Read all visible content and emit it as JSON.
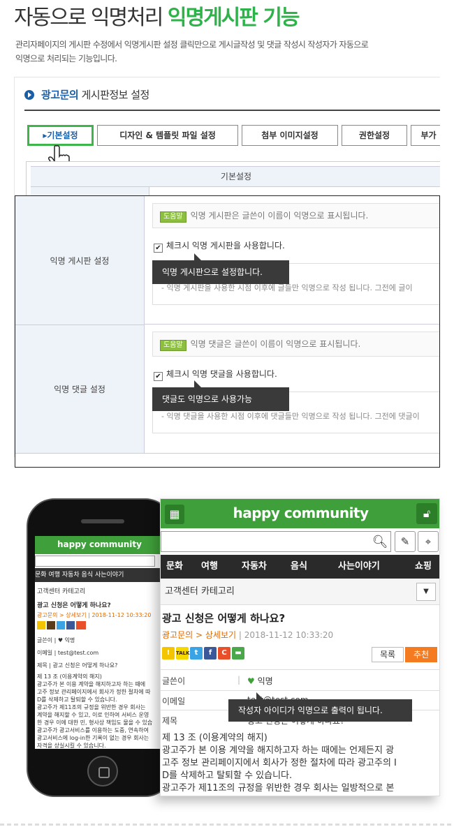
{
  "header": {
    "title_plain": "자동으로 익명처리 ",
    "title_highlight": "익명게시판 기능",
    "description_line1": "관리자페이지의 게시판 수정에서 익명게시판 설정 클릭만으로 게시글작성 및 댓글 작성시 작성자가 자동으로",
    "description_line2": "익명으로 처리되는 기능입니다."
  },
  "panel": {
    "heading_blue": "광고문의",
    "heading_rest": " 게시판정보 설정",
    "tabs": [
      "▸기본설정",
      "디자인 & 템플릿 파일 설정",
      "첨부 이미지설정",
      "권한설정",
      "부가"
    ],
    "table_header": "기본설정"
  },
  "settings": {
    "anon_board": {
      "label": "익명 게시판 설정",
      "help_badge": "도움말",
      "help_text": "익명 게시판은 글쓴이 이름이 익명으로 표시됩니다.",
      "checkbox_label": "체크시 익명 게시판을 사용합니다.",
      "checked": true,
      "note": "- 익명 게시판을 사용한 시점 이후에 글들만 익명으로 작성 됩니다. 그전에 글이",
      "tooltip": "익명 게시판으로 설정합니다."
    },
    "anon_comment": {
      "label": "익명 댓글 설정",
      "help_badge": "도움말",
      "help_text": "익명 댓글은 글쓴이 이름이 익명으로 표시됩니다.",
      "checkbox_label": "체크시 익명 댓글을 사용합니다.",
      "checked": true,
      "note": "- 익명 댓글을 사용한 시점 이후에 댓글들만 익명으로 작성 됩니다. 그전에 댓글이",
      "tooltip": "댓글도 익명으로 사용가능"
    }
  },
  "phone": {
    "logo": "happy community",
    "menu": "문화   여행    자동차    음식    사는이야기",
    "category": "고객센터 카테고리",
    "post_title": "광고 신청은 어떻게 하나요?",
    "crumb": "광고문의 > 상세보기  |  2018-11-12 10:33:20",
    "writer": "글쓴이    |  ♥ 익명",
    "email": "이메일    |  test@test.com",
    "subject": "제목       |  광고 신청은 어떻게 하나요?",
    "lines": [
      "제 13 조 (이용계약의 해지)",
      "광고주가 본 이용 계약을 해지하고자 하는 때에",
      "고주 정보 관리페이지에서 회사가 정한 절차에 따",
      "D를 삭제하고 탈퇴할 수 있습니다.",
      "광고주가 제11조의 규정을 위반한 경우 회사는",
      "계약을 해지할 수 있고, 이로 인하여 서비스 운영",
      "한 경우 이에 대한 민, 형사상 책임도 물을 수 있습",
      "광고주가 광고서비스를 이용하는 도중, 연속하여",
      "광고서비스에 log-in한 기록이 없는 경우 회사는",
      "자격을 상실시킬 수 있습니다."
    ]
  },
  "zoom": {
    "logo": "happy community",
    "nav": [
      "문화",
      "여행",
      "자동차",
      "음식",
      "사는이야기",
      "쇼핑"
    ],
    "category": "고객센터 카테고리",
    "post_title": "광고 신청은 어떻게 하나요?",
    "crumb_board": "광고문의",
    "crumb_sep": " > ",
    "crumb_page": "상세보기",
    "crumb_date": "|   2018-11-12 10:33:20",
    "share_icons": [
      "kakaostory-icon",
      "kakaotalk-icon",
      "twitter-icon",
      "facebook-icon",
      "cyworld-icon",
      "band-icon"
    ],
    "list_button": "목록",
    "recommend_button": "추천",
    "writer_key": "글쓴이",
    "writer_value": "익명",
    "email_key": "이메일",
    "email_value": "test@test.com",
    "subject_key": "제목",
    "subject_value": "광고 신청은 어떻게 하나요?",
    "body": [
      "제 13 조 (이용계약의 해지)",
      "광고주가 본 이용 계약을 해지하고자 하는 때에는 언제든지 광",
      "고주 정보 관리페이지에서 회사가 정한 절차에 따라 광고주의 I",
      "D를 삭제하고 탈퇴할 수 있습니다.",
      "광고주가 제11조의 규정을 위반한 경우 회사는 일방적으로 본"
    ],
    "tooltip": "작성자 아이디가 익명으로 출력이 됩니다."
  },
  "colors": {
    "accent_green": "#2eb24a",
    "brand_blue": "#1a5ea8",
    "orange": "#f47b20",
    "tooltip_bg": "#3a3a3a"
  }
}
